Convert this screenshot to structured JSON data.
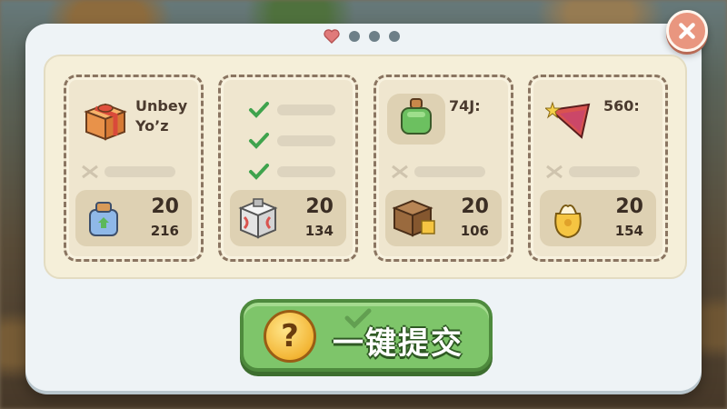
{
  "dialog": {
    "close_icon": "close-icon",
    "pager": {
      "active": "heart",
      "count": 4
    }
  },
  "cards": [
    {
      "title_line1": "Unbey",
      "title_line2": "Yo’z",
      "reward_top": "20",
      "reward_bot": "216"
    },
    {
      "checks": 3,
      "reward_top": "20",
      "reward_bot": "134"
    },
    {
      "title_line1": "74J:",
      "reward_top": "20",
      "reward_bot": "106"
    },
    {
      "title_line1": "560:",
      "reward_top": "20",
      "reward_bot": "154"
    }
  ],
  "submit": {
    "label": "一键提交",
    "icon": "?"
  },
  "colors": {
    "accent_green": "#7ec56a",
    "close_red": "#e9967f",
    "card_bg": "#efe6cf"
  }
}
